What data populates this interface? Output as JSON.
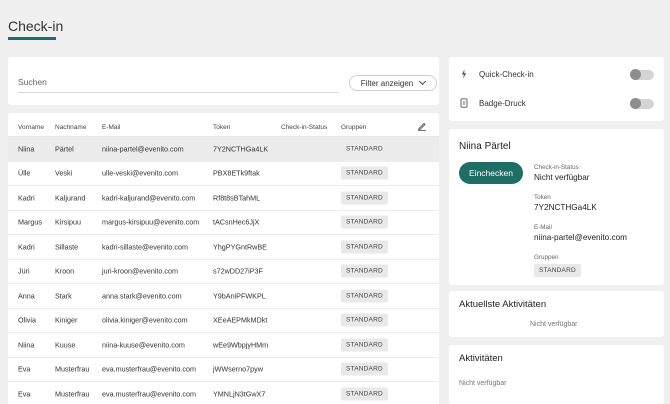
{
  "page": {
    "title": "Check-in"
  },
  "search": {
    "placeholder": "Suchen",
    "filter_label": "Filter anzeigen"
  },
  "table": {
    "columns": [
      "Vorname",
      "Nachname",
      "E-Mail",
      "Token",
      "Check-in-Status",
      "Gruppen"
    ],
    "rows": [
      {
        "first": "Niina",
        "last": "Pärtel",
        "email": "niina-partel@evenito.com",
        "token": "7Y2NCTHGa4LK",
        "status": "",
        "group": "STANDARD"
      },
      {
        "first": "Ülle",
        "last": "Veski",
        "email": "ulle-veski@evenito.com",
        "token": "PBX8ETk9ftak",
        "status": "",
        "group": "STANDARD"
      },
      {
        "first": "Kadri",
        "last": "Kaljurand",
        "email": "kadri-kaljurand@evenito.com",
        "token": "Rf8t8sBTahML",
        "status": "",
        "group": "STANDARD"
      },
      {
        "first": "Margus",
        "last": "Kirsipuu",
        "email": "margus-kirsipuu@evenito.com",
        "token": "tACsnHec6JjX",
        "status": "",
        "group": "STANDARD"
      },
      {
        "first": "Kadri",
        "last": "Sillaste",
        "email": "kadri-sillaste@evenito.com",
        "token": "YhgPYGntRwBE",
        "status": "",
        "group": "STANDARD"
      },
      {
        "first": "Jüri",
        "last": "Kroon",
        "email": "juri-kroon@evenito.com",
        "token": "s72wDD27iP3F",
        "status": "",
        "group": "STANDARD"
      },
      {
        "first": "Anna",
        "last": "Stark",
        "email": "anna.stark@evenito.com",
        "token": "Y9bAniPFWKPL",
        "status": "",
        "group": "STANDARD"
      },
      {
        "first": "Olivia",
        "last": "Kiniger",
        "email": "olivia.kiniger@evenito.com",
        "token": "XEeAEPMkMDkt",
        "status": "",
        "group": "STANDARD"
      },
      {
        "first": "Niina",
        "last": "Kuuse",
        "email": "niina-kuuse@evenito.com",
        "token": "wEe9WbpjyHMm",
        "status": "",
        "group": "STANDARD"
      },
      {
        "first": "Eva",
        "last": "Musterfrau",
        "email": "eva.musterfrau@evenito.com",
        "token": "jWWserno7pyw",
        "status": "",
        "group": "STANDARD"
      },
      {
        "first": "Eva",
        "last": "Musterfrau",
        "email": "eva.musterfrau@evenito.com",
        "token": "YMNLjN3tGwX7",
        "status": "",
        "group": "STANDARD"
      }
    ]
  },
  "toggles": {
    "quick_checkin": {
      "label": "Quick-Check-in",
      "on": false,
      "icon": "lightning-icon"
    },
    "badge_print": {
      "label": "Badge-Druck",
      "on": false,
      "icon": "badge-icon"
    }
  },
  "detail": {
    "name": "Niina Pärtel",
    "checkin_button": "Einchecken",
    "status_label": "Check-in-Status",
    "status_value": "Nicht verfügbar",
    "token_label": "Token",
    "token_value": "7Y2NCTHGa4LK",
    "email_label": "E-Mail",
    "email_value": "niina-partel@evenito.com",
    "groups_label": "Gruppen",
    "group_value": "STANDARD"
  },
  "latest_activities": {
    "title": "Aktuellste Aktivitäten",
    "empty": "Nicht verfügbar"
  },
  "activities": {
    "title": "Aktivitäten",
    "empty": "Nicht verfügbar"
  },
  "colors": {
    "accent": "#1f6e66",
    "background": "#f0f0f0"
  }
}
